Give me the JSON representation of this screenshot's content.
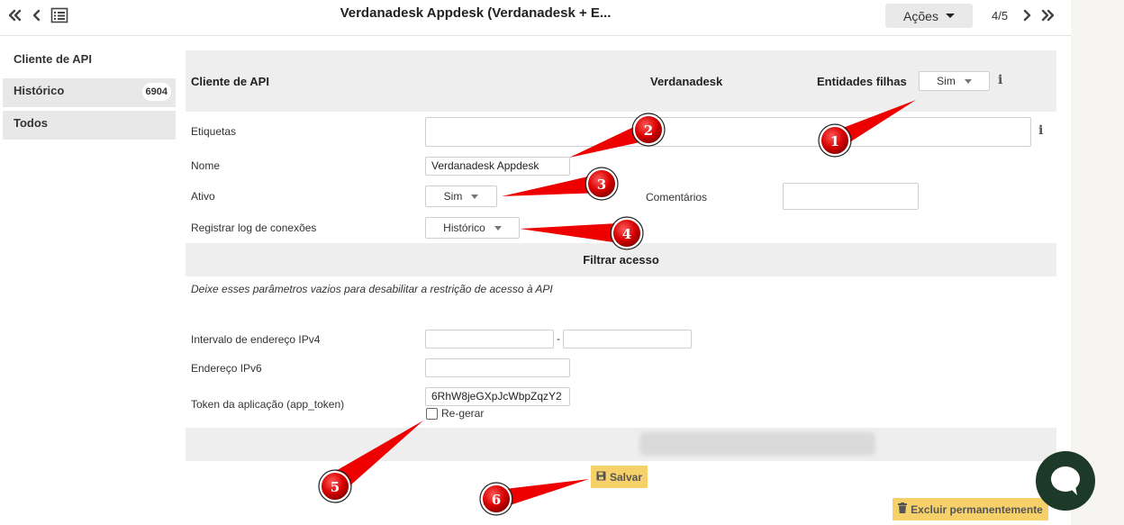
{
  "header": {
    "title": "Verdanadesk Appdesk (Verdanadesk + E...",
    "actions_label": "Ações",
    "pager": "4/5"
  },
  "sidebar": {
    "items": [
      {
        "label": "Cliente de API"
      },
      {
        "label": "Histórico",
        "badge": "6904"
      },
      {
        "label": "Todos"
      }
    ]
  },
  "form": {
    "section_title": "Cliente de API",
    "entity_name": "Verdanadesk",
    "child_entities_label": "Entidades filhas",
    "child_entities_value": "Sim",
    "labels_label": "Etiquetas",
    "labels_value": "",
    "name_label": "Nome",
    "name_value": "Verdanadesk Appdesk",
    "active_label": "Ativo",
    "active_value": "Sim",
    "comments_label": "Comentários",
    "comments_value": "",
    "log_label": "Registrar log de conexões",
    "log_value": "Histórico",
    "filter_title": "Filtrar acesso",
    "filter_note": "Deixe esses parâmetros vazios para desabilitar a restrição de acesso à API",
    "ipv4_label": "Intervalo de endereço IPv4",
    "ipv4_from": "",
    "ipv4_separator": "-",
    "ipv4_to": "",
    "ipv6_label": "Endereço IPv6",
    "ipv6_value": "",
    "token_label": "Token da aplicação (app_token)",
    "token_value": "6RhW8jeGXpJcWbpZqzY2",
    "regen_label": "Re-gerar",
    "save_label": "Salvar",
    "delete_label": "Excluir permanentemente"
  },
  "annotations": [
    "1",
    "2",
    "3",
    "4",
    "5",
    "6"
  ],
  "colors": {
    "save_button": "#f6d16a",
    "arrow": "#ee0000",
    "chat_bubble": "#1d3a28"
  }
}
